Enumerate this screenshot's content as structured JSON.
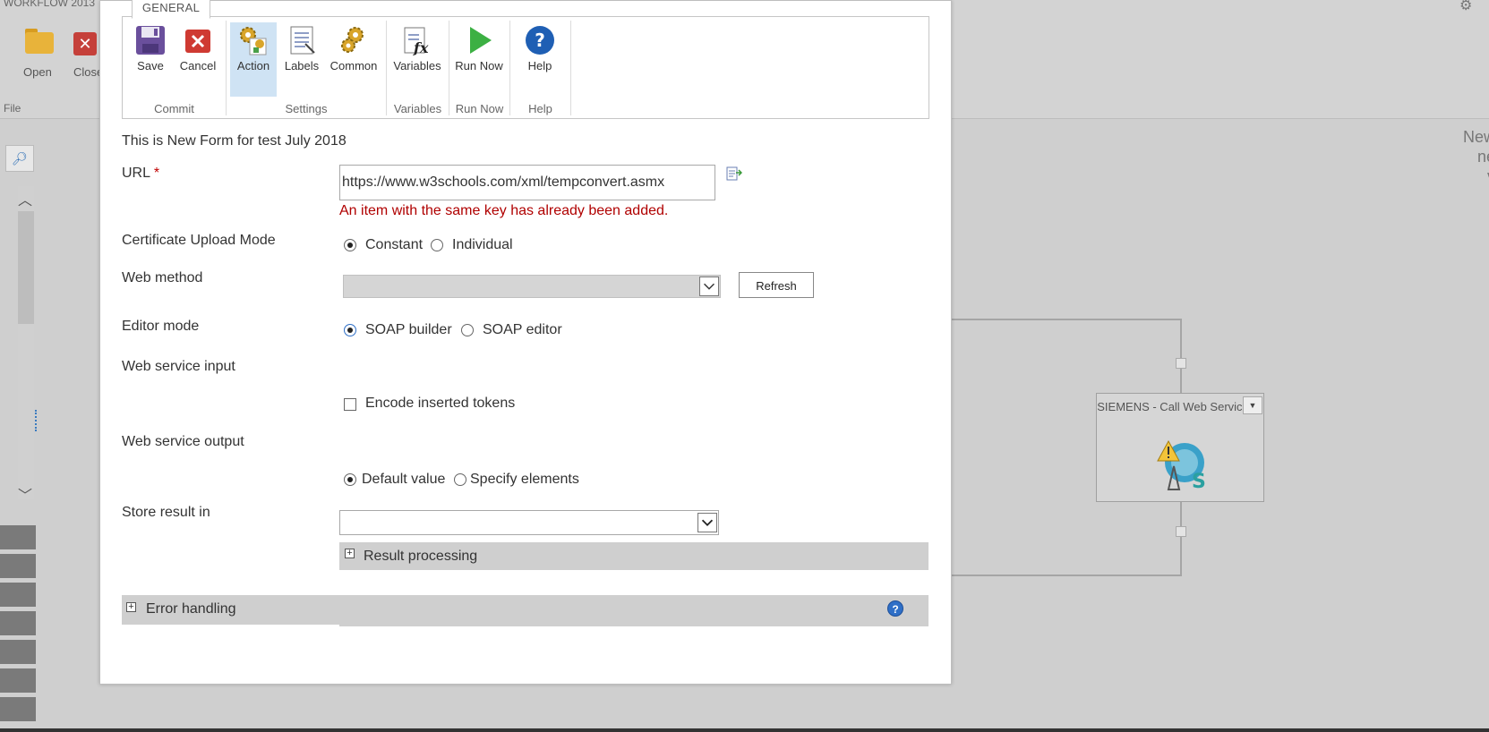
{
  "background": {
    "title": "WORKFLOW 2013",
    "ribbon": {
      "open_label": "Open",
      "close_label": "Close",
      "file_group": "File"
    },
    "right_text": "New\nne\nv",
    "node": {
      "title": "SIEMENS - Call Web Service"
    }
  },
  "dialog": {
    "tab": "GENERAL",
    "ribbon": {
      "buttons": [
        {
          "label": "Save",
          "icon": "save-icon"
        },
        {
          "label": "Cancel",
          "icon": "cancel-icon"
        },
        {
          "label": "Action",
          "icon": "action-gears-icon",
          "active": true
        },
        {
          "label": "Labels",
          "icon": "labels-icon"
        },
        {
          "label": "Common",
          "icon": "common-gears-icon"
        },
        {
          "label": "Variables",
          "icon": "variables-fx-icon"
        },
        {
          "label": "Run Now",
          "icon": "run-play-icon"
        },
        {
          "label": "Help",
          "icon": "help-icon"
        }
      ],
      "groups": [
        "Commit",
        "Settings",
        "Variables",
        "Run Now",
        "Help"
      ]
    },
    "form": {
      "description": "This is New Form for test July 2018",
      "url_label": "URL",
      "url_required_mark": "*",
      "url_value": "https://www.w3schools.com/xml/tempconvert.asmx",
      "url_error": "An item with the same key has already been added.",
      "cert_label": "Certificate Upload Mode",
      "cert_options": [
        "Constant",
        "Individual"
      ],
      "cert_selected": "Constant",
      "webmethod_label": "Web method",
      "webmethod_value": "",
      "refresh_label": "Refresh",
      "editor_label": "Editor mode",
      "editor_options": [
        "SOAP builder",
        "SOAP editor"
      ],
      "editor_selected": "SOAP builder",
      "input_label": "Web service input",
      "encode_label": "Encode inserted tokens",
      "encode_checked": false,
      "output_label": "Web service output",
      "output_options": [
        "Default value",
        "Specify elements"
      ],
      "output_selected": "Default value",
      "store_label": "Store result in",
      "store_value": "",
      "result_processing_label": "Result processing",
      "error_handling_label": "Error handling"
    }
  }
}
